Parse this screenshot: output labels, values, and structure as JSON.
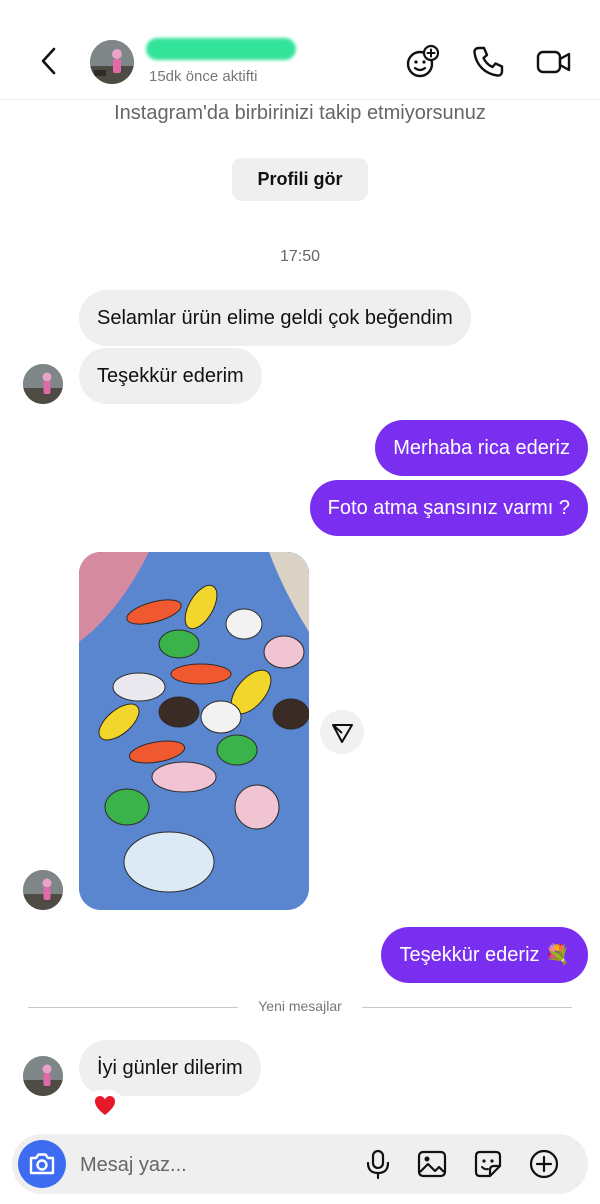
{
  "header": {
    "status": "15dk önce aktifti",
    "icons": [
      "back-icon",
      "sticker-effects-icon",
      "phone-icon",
      "video-icon"
    ]
  },
  "info": {
    "not_following": "Instagram'da birbirinizi takip etmiyorsunuz",
    "profile_button": "Profili gör"
  },
  "chat": {
    "time": "17:50",
    "messages": [
      {
        "from": "them",
        "text": "Selamlar ürün elime geldi çok beğendim"
      },
      {
        "from": "them",
        "text": "Teşekkür ederim"
      },
      {
        "from": "me",
        "text": "Merhaba rica ederiz"
      },
      {
        "from": "me",
        "text": "Foto atma şansınız varmı ?"
      },
      {
        "from": "them",
        "type": "photo"
      },
      {
        "from": "me",
        "text": "Teşekkür ederiz 💐"
      },
      {
        "from": "them",
        "text": "İyi günler dilerim",
        "reaction": "❤️"
      }
    ],
    "new_messages_label": "Yeni mesajlar"
  },
  "composer": {
    "placeholder": "Mesaj yaz...",
    "icons": [
      "camera-icon",
      "microphone-icon",
      "gallery-icon",
      "sticker-icon",
      "add-icon"
    ]
  },
  "colors": {
    "outgoing_bubble": "#7a2ff0",
    "incoming_bubble": "#efefef",
    "camera_button": "#3d6cf1"
  }
}
